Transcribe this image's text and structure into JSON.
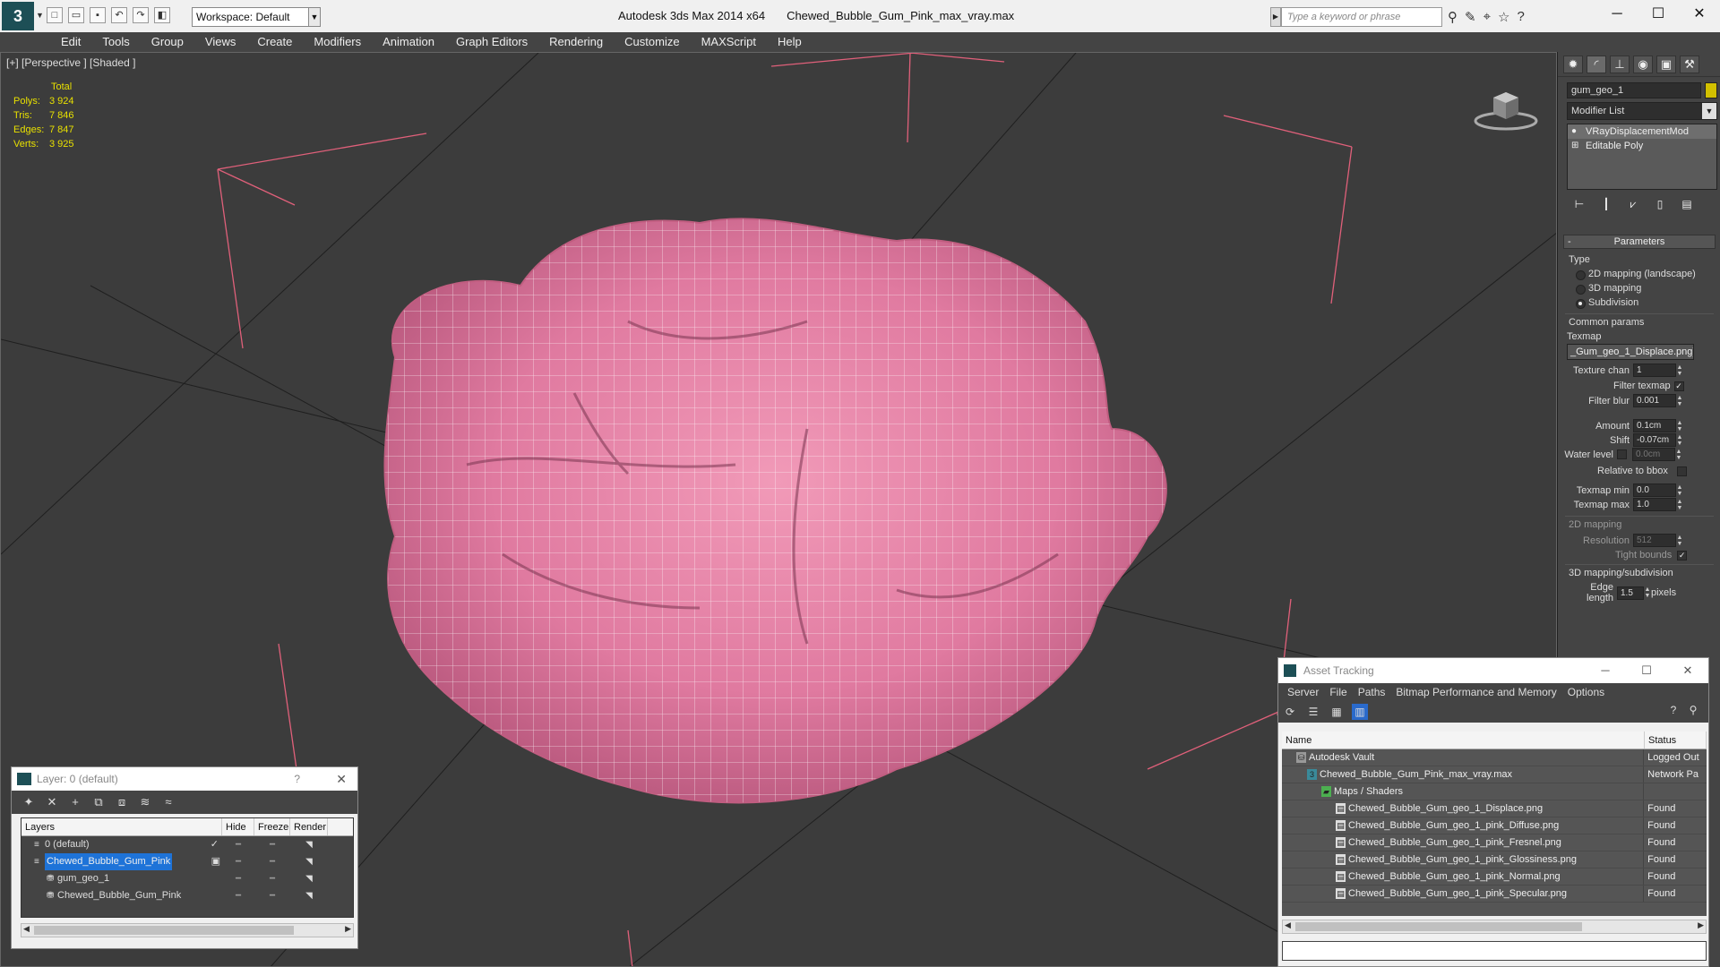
{
  "titlebar": {
    "workspace_label": "Workspace: Default",
    "app_title": "Autodesk 3ds Max  2014 x64",
    "file_title": "Chewed_Bubble_Gum_Pink_max_vray.max",
    "search_placeholder": "Type a keyword or phrase"
  },
  "menu": [
    "Edit",
    "Tools",
    "Group",
    "Views",
    "Create",
    "Modifiers",
    "Animation",
    "Graph Editors",
    "Rendering",
    "Customize",
    "MAXScript",
    "Help"
  ],
  "viewport": {
    "label": "[+] [Perspective ] [Shaded ]",
    "stats_header": "Total",
    "stats": [
      {
        "k": "Polys:",
        "v": "3 924"
      },
      {
        "k": "Tris:",
        "v": "7 846"
      },
      {
        "k": "Edges:",
        "v": "7 847"
      },
      {
        "k": "Verts:",
        "v": "3 925"
      }
    ]
  },
  "command_panel": {
    "object_name": "gum_geo_1",
    "modifier_list": "Modifier List",
    "stack": [
      "VRayDisplacementMod",
      "Editable Poly"
    ],
    "rollout_title": "Parameters",
    "type_label": "Type",
    "radios": [
      "2D mapping (landscape)",
      "3D mapping",
      "Subdivision"
    ],
    "common_params": "Common params",
    "texmap_label": "Texmap",
    "texmap_value": "_Gum_geo_1_Displace.png)",
    "texture_chan_label": "Texture chan",
    "texture_chan_value": "1",
    "filter_texmap": "Filter texmap",
    "filter_blur_label": "Filter blur",
    "filter_blur_value": "0.001",
    "amount_label": "Amount",
    "amount_value": "0.1cm",
    "shift_label": "Shift",
    "shift_value": "-0.07cm",
    "water_level_label": "Water level",
    "water_level_value": "0.0cm",
    "relative_bbox": "Relative to bbox",
    "texmap_min_label": "Texmap min",
    "texmap_min_value": "0.0",
    "texmap_max_label": "Texmap max",
    "texmap_max_value": "1.0",
    "mapping2d_label": "2D mapping",
    "resolution_label": "Resolution",
    "resolution_value": "512",
    "tight_bounds": "Tight bounds",
    "mapping3d_label": "3D mapping/subdivision",
    "edge_length_label": "Edge length",
    "edge_length_value": "1.5",
    "pixels_label": "pixels"
  },
  "layer_window": {
    "title": "Layer: 0 (default)",
    "help": "?",
    "columns": [
      "Layers",
      "Hide",
      "Freeze",
      "Render"
    ],
    "rows": [
      {
        "name": "0 (default)",
        "indent": 14
      },
      {
        "name": "Chewed_Bubble_Gum_Pink",
        "indent": 14
      },
      {
        "name": "gum_geo_1",
        "indent": 28
      },
      {
        "name": "Chewed_Bubble_Gum_Pink",
        "indent": 28
      }
    ]
  },
  "asset_window": {
    "title": "Asset Tracking",
    "menu": [
      "Server",
      "File",
      "Paths",
      "Bitmap Performance and Memory",
      "Options"
    ],
    "columns": [
      "Name",
      "Status"
    ],
    "rows": [
      {
        "name": "Autodesk Vault",
        "status": "Logged Out",
        "indent": 16
      },
      {
        "name": "Chewed_Bubble_Gum_Pink_max_vray.max",
        "status": "Network Pa",
        "indent": 28
      },
      {
        "name": "Maps / Shaders",
        "status": "",
        "indent": 44
      },
      {
        "name": "Chewed_Bubble_Gum_geo_1_Displace.png",
        "status": "Found",
        "indent": 60
      },
      {
        "name": "Chewed_Bubble_Gum_geo_1_pink_Diffuse.png",
        "status": "Found",
        "indent": 60
      },
      {
        "name": "Chewed_Bubble_Gum_geo_1_pink_Fresnel.png",
        "status": "Found",
        "indent": 60
      },
      {
        "name": "Chewed_Bubble_Gum_geo_1_pink_Glossiness.png",
        "status": "Found",
        "indent": 60
      },
      {
        "name": "Chewed_Bubble_Gum_geo_1_pink_Normal.png",
        "status": "Found",
        "indent": 60
      },
      {
        "name": "Chewed_Bubble_Gum_geo_1_pink_Specular.png",
        "status": "Found",
        "indent": 60
      }
    ]
  },
  "colors": {
    "gum": "#e8749a",
    "selection": "#1e73d8",
    "stats": "#e8e000",
    "object_color": "#d2c000"
  }
}
